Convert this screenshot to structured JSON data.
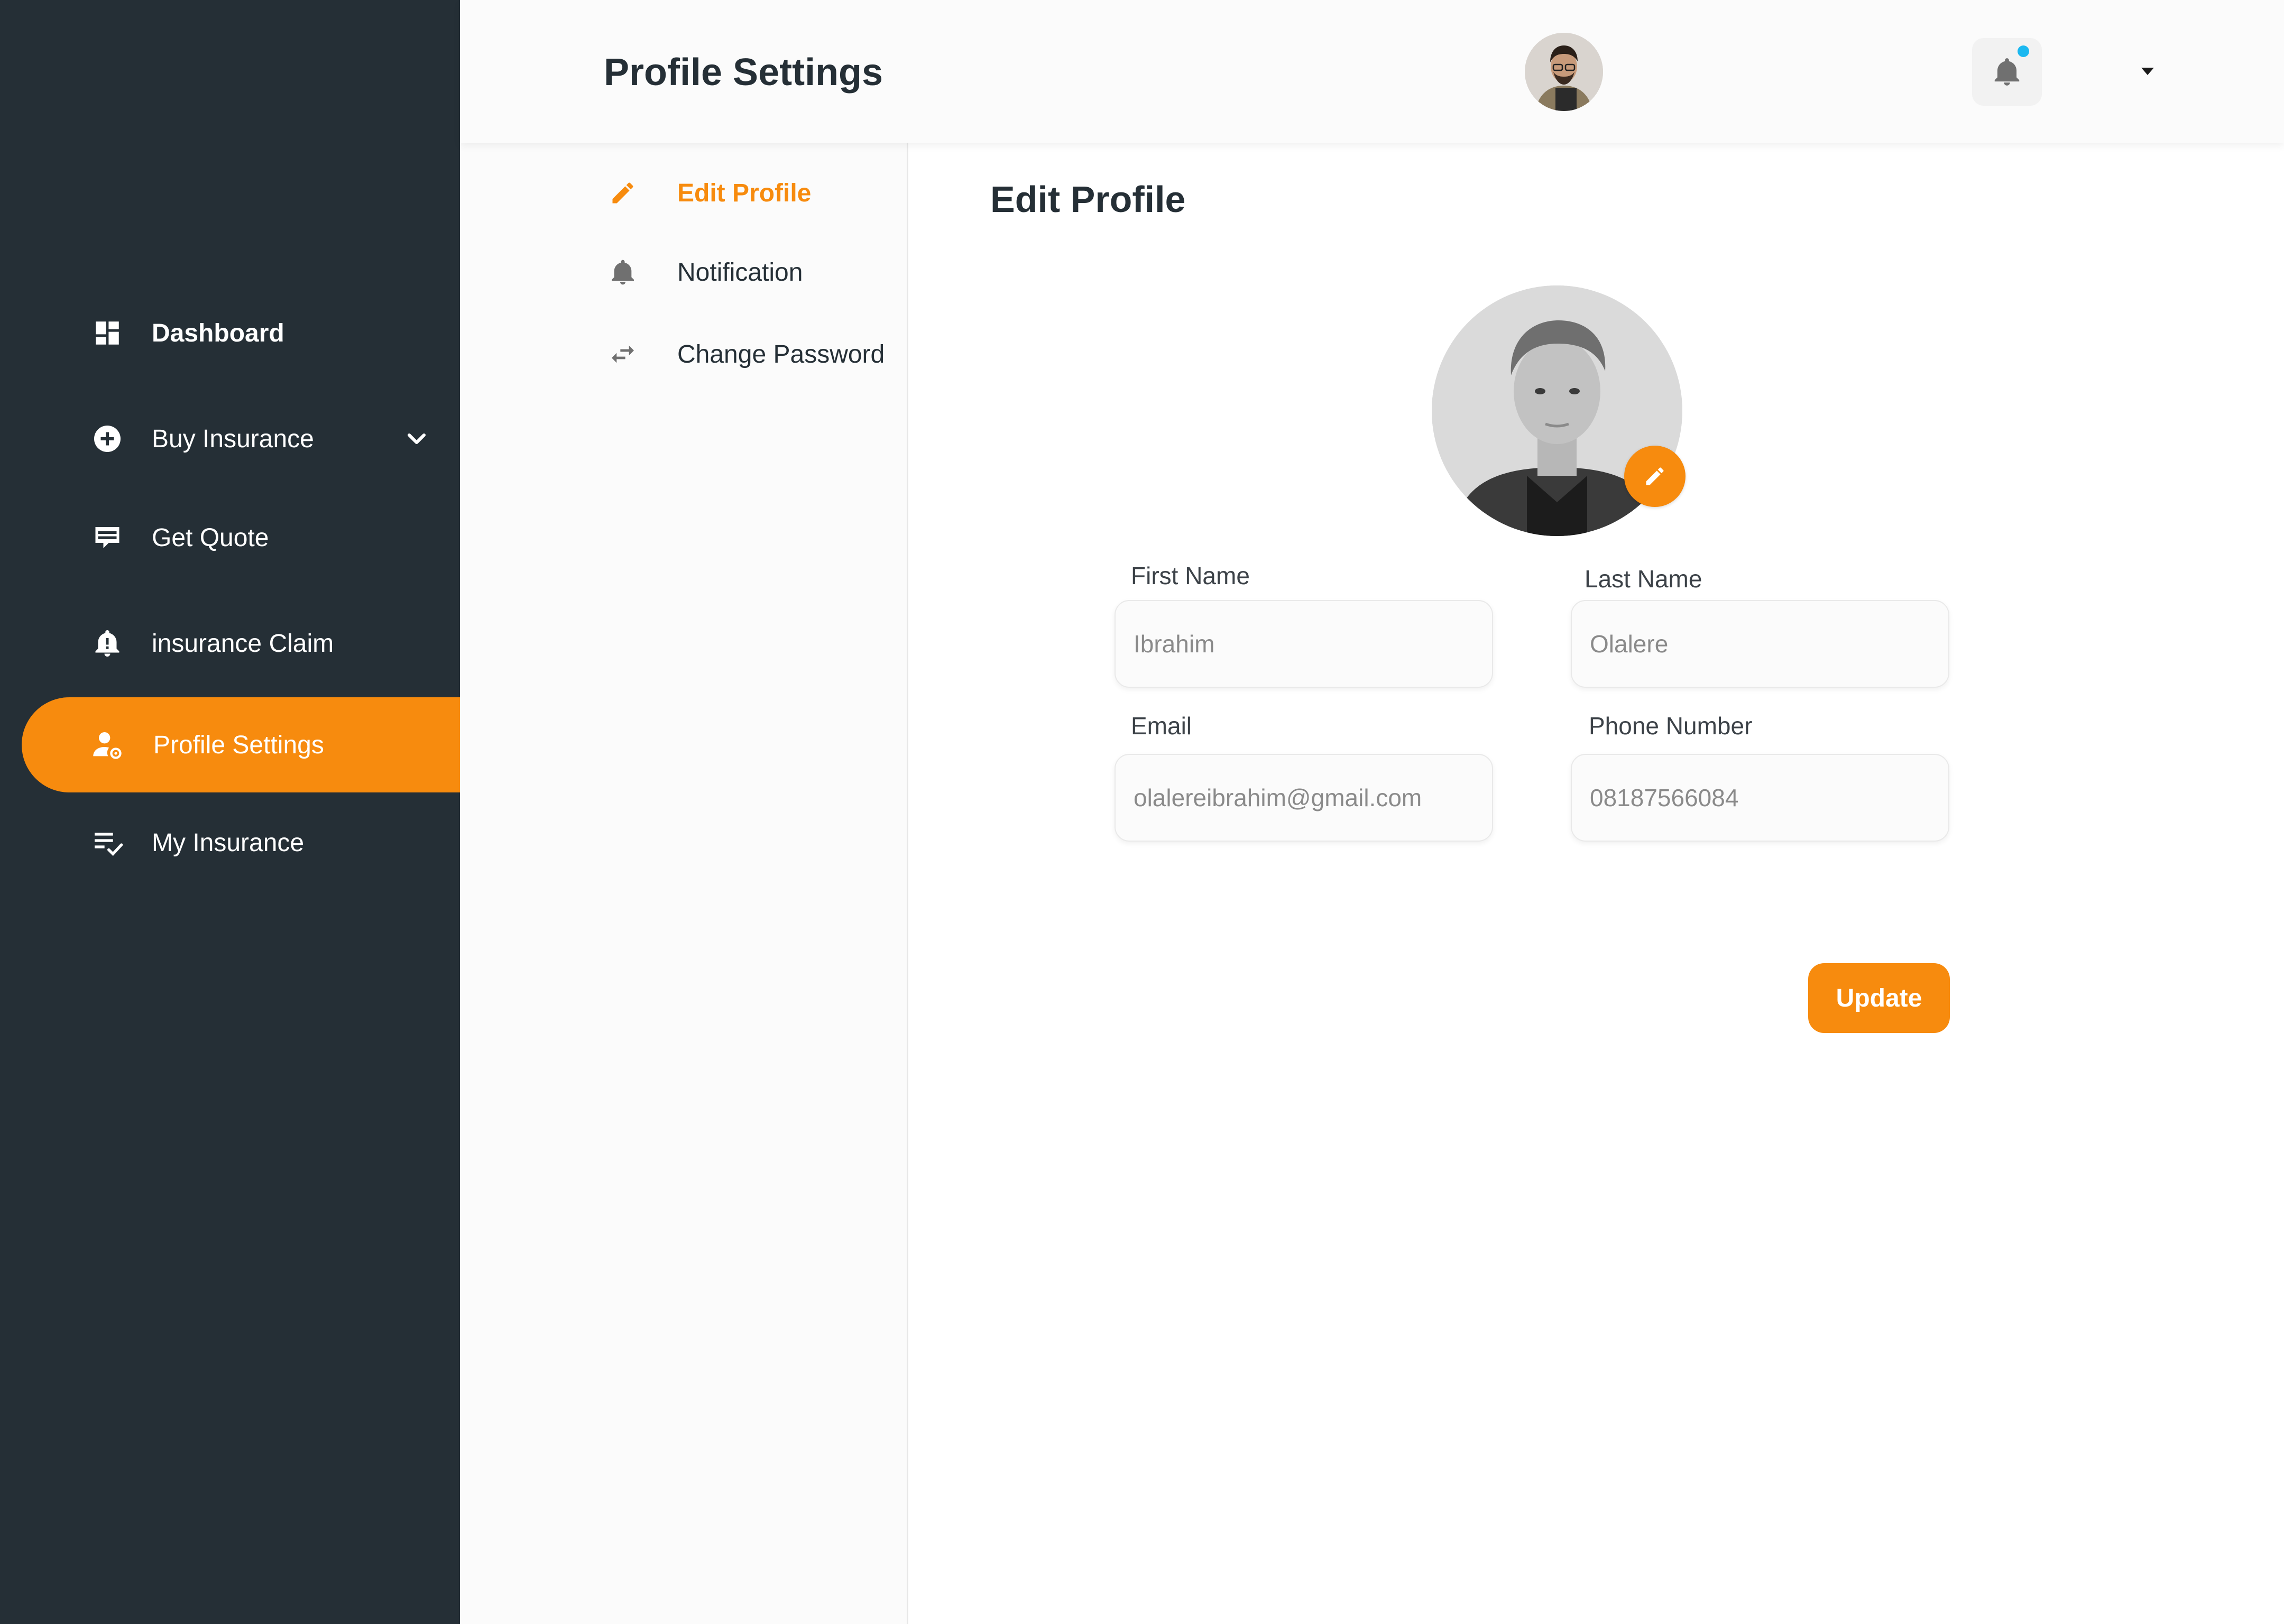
{
  "sidebar": {
    "items": [
      {
        "label": "Dashboard",
        "icon": "dashboard-icon"
      },
      {
        "label": "Buy Insurance",
        "icon": "plus-circle-icon",
        "expandable": true
      },
      {
        "label": "Get Quote",
        "icon": "quote-card-icon"
      },
      {
        "label": "insurance Claim",
        "icon": "alert-bell-icon"
      },
      {
        "label": "Profile Settings",
        "icon": "user-settings-icon",
        "active": true
      },
      {
        "label": "My Insurance",
        "icon": "checklist-icon"
      }
    ]
  },
  "header": {
    "title": "Profile Settings",
    "notification_icon": "bell-icon",
    "has_unread_notifications": true
  },
  "settings_nav": {
    "items": [
      {
        "label": "Edit Profile",
        "icon": "pencil-icon",
        "active": true
      },
      {
        "label": "Notification",
        "icon": "bell-icon"
      },
      {
        "label": "Change Password",
        "icon": "swap-arrows-icon"
      }
    ]
  },
  "form": {
    "title": "Edit Profile",
    "first_name": {
      "label": "First Name",
      "value": "Ibrahim"
    },
    "last_name": {
      "label": "Last Name",
      "value": "Olalere"
    },
    "email": {
      "label": "Email",
      "value": "olalereibrahim@gmail.com"
    },
    "phone": {
      "label": "Phone Number",
      "value": "08187566084"
    },
    "submit_label": "Update"
  },
  "colors": {
    "accent": "#f78b0e",
    "sidebar_bg": "#252f36",
    "notification_dot": "#1bb8f0"
  }
}
